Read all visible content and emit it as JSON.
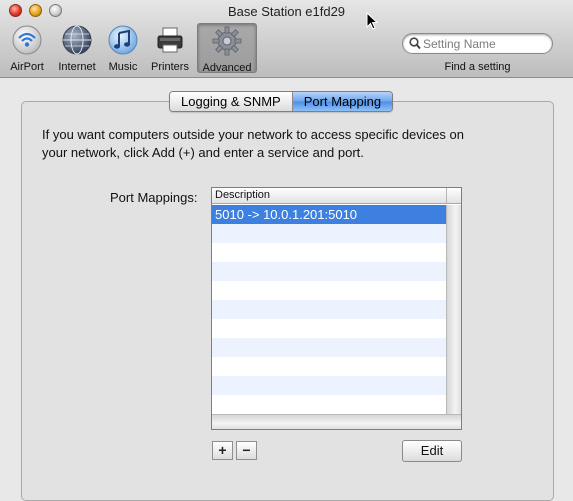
{
  "window": {
    "title": "Base Station e1fd29"
  },
  "toolbar": {
    "items": [
      {
        "label": "AirPort",
        "icon": "airport-icon"
      },
      {
        "label": "Internet",
        "icon": "internet-globe-icon"
      },
      {
        "label": "Music",
        "icon": "music-note-icon"
      },
      {
        "label": "Printers",
        "icon": "printer-icon"
      },
      {
        "label": "Advanced",
        "icon": "gear-icon",
        "selected": true
      }
    ],
    "search": {
      "placeholder": "Setting Name",
      "caption": "Find a setting"
    }
  },
  "tabs": [
    {
      "label": "Logging & SNMP",
      "active": false
    },
    {
      "label": "Port Mapping",
      "active": true
    }
  ],
  "content": {
    "intro_line1": "If you want computers outside your network to access specific devices on",
    "intro_line2": "your network, click Add (+) and enter a service and port.",
    "mappings_label": "Port Mappings:",
    "table": {
      "column": "Description",
      "rows": [
        "5010 -> 10.0.1.201:5010"
      ]
    },
    "add_label": "+",
    "remove_label": "−",
    "edit_label": "Edit"
  },
  "colors": {
    "selection": "#3d80df",
    "row_alt": "#edf3fe",
    "tab_active": "#6aa6ee"
  }
}
